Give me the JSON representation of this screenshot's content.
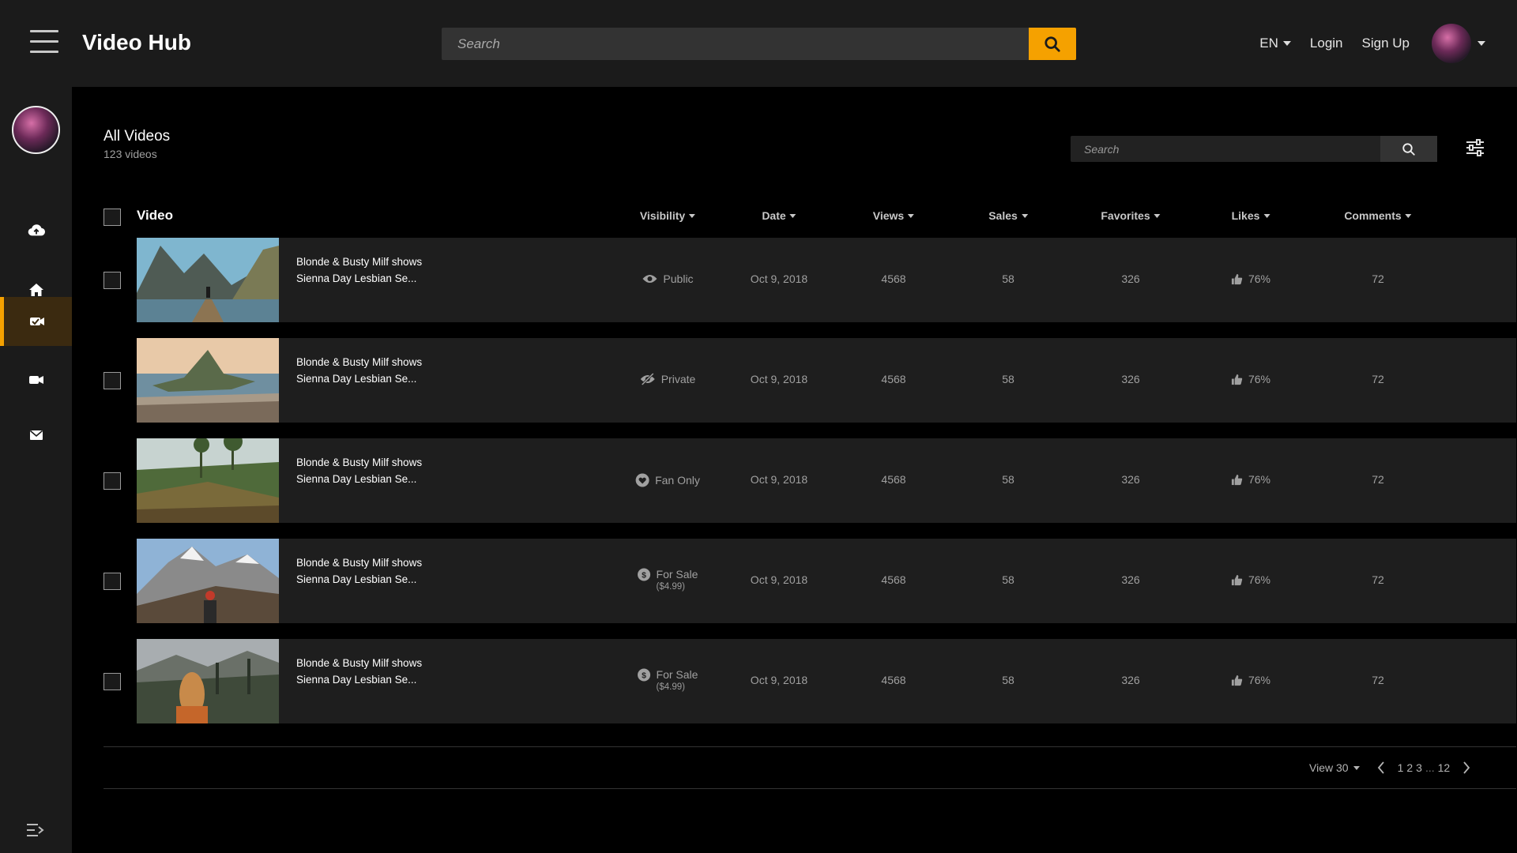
{
  "app": {
    "title": "Video Hub"
  },
  "header": {
    "search_placeholder": "Search",
    "language": "EN",
    "login": "Login",
    "signup": "Sign Up"
  },
  "colors": {
    "accent": "#f5a100",
    "row_bg": "#1e1e1e",
    "header_bg": "#1b1b1b"
  },
  "sidebar": {
    "items": [
      {
        "icon": "cloud-upload-icon"
      },
      {
        "icon": "home-icon"
      },
      {
        "icon": "video-tag-icon",
        "active": true
      },
      {
        "icon": "video-camera-icon"
      },
      {
        "icon": "envelope-icon"
      }
    ],
    "collapse_icon": "collapse-menu-icon"
  },
  "main": {
    "title": "All Videos",
    "subtitle": "123 videos",
    "search_placeholder": "Search",
    "columns": {
      "video": "Video",
      "visibility": "Visibility",
      "date": "Date",
      "views": "Views",
      "sales": "Sales",
      "favorites": "Favorites",
      "likes": "Likes",
      "comments": "Comments"
    },
    "rows": [
      {
        "title_line1": "Blonde & Busty Milf shows",
        "title_line2": "Sienna Day Lesbian Se...",
        "visibility": "Public",
        "visibility_icon": "eye-icon",
        "price": "",
        "date": "Oct 9, 2018",
        "views": "4568",
        "sales": "58",
        "favorites": "326",
        "likes": "76%",
        "comments": "72"
      },
      {
        "title_line1": "Blonde & Busty Milf shows",
        "title_line2": "Sienna Day Lesbian Se...",
        "visibility": "Private",
        "visibility_icon": "eye-slash-icon",
        "price": "",
        "date": "Oct 9, 2018",
        "views": "4568",
        "sales": "58",
        "favorites": "326",
        "likes": "76%",
        "comments": "72"
      },
      {
        "title_line1": "Blonde & Busty Milf shows",
        "title_line2": "Sienna Day Lesbian Se...",
        "visibility": "Fan Only",
        "visibility_icon": "heart-icon",
        "price": "",
        "date": "Oct 9, 2018",
        "views": "4568",
        "sales": "58",
        "favorites": "326",
        "likes": "76%",
        "comments": "72"
      },
      {
        "title_line1": "Blonde & Busty Milf shows",
        "title_line2": "Sienna Day Lesbian Se...",
        "visibility": "For Sale",
        "visibility_icon": "dollar-icon",
        "price": "($4.99)",
        "date": "Oct 9, 2018",
        "views": "4568",
        "sales": "58",
        "favorites": "326",
        "likes": "76%",
        "comments": "72"
      },
      {
        "title_line1": "Blonde & Busty Milf shows",
        "title_line2": "Sienna Day Lesbian Se...",
        "visibility": "For Sale",
        "visibility_icon": "dollar-icon",
        "price": "($4.99)",
        "date": "Oct 9, 2018",
        "views": "4568",
        "sales": "58",
        "favorites": "326",
        "likes": "76%",
        "comments": "72"
      }
    ],
    "pagination": {
      "view_label": "View 30",
      "pages": [
        "1",
        "2",
        "3",
        "...",
        "12"
      ]
    }
  }
}
